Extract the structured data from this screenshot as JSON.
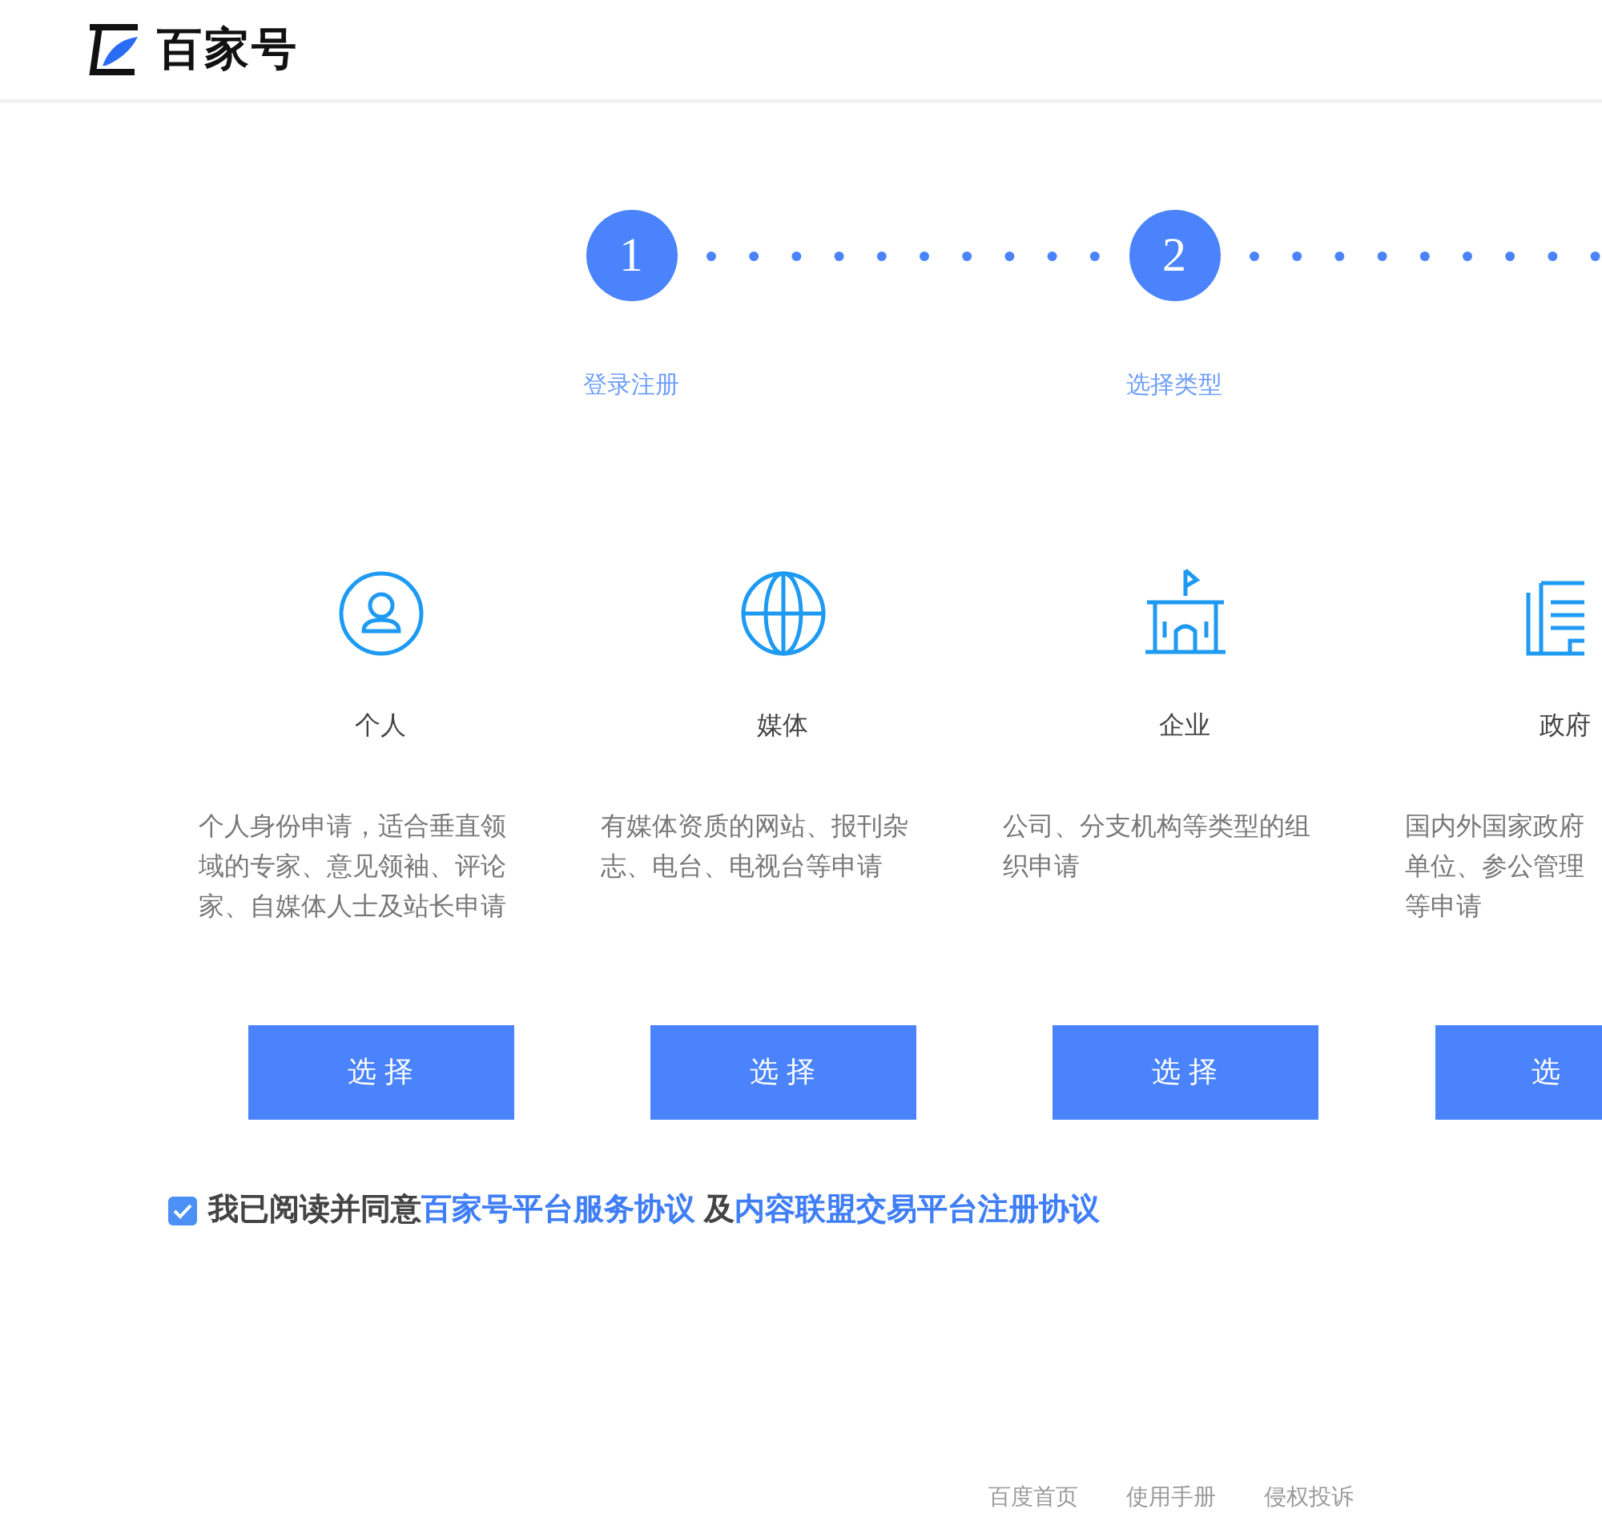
{
  "header": {
    "logo_text": "百家号"
  },
  "steps": [
    {
      "number": "1",
      "label": "登录注册"
    },
    {
      "number": "2",
      "label": "选择类型"
    }
  ],
  "cards": [
    {
      "kind": "person",
      "title": "个人",
      "lines": [
        "个人身份申请，适合垂直领",
        "域的专家、意见领袖、评论",
        "家、自媒体人士及站长申请"
      ],
      "button": "选 择"
    },
    {
      "kind": "globe",
      "title": "媒体",
      "lines": [
        "有媒体资质的网站、报刊杂",
        "志、电台、电视台等申请"
      ],
      "button": "选 择"
    },
    {
      "kind": "school",
      "title": "企业",
      "lines": [
        "公司、分支机构等类型的组",
        "织申请"
      ],
      "button": "选 择"
    },
    {
      "kind": "office",
      "title": "政府",
      "lines": [
        "国内外国家政府",
        "单位、参公管理",
        "等申请"
      ],
      "button": "选"
    }
  ],
  "agreement": {
    "checked": true,
    "text": "我已阅读并同意",
    "link_1": "百家号平台服务协议",
    "joiner": "及",
    "link_2": "内容联盟交易平台注册协议"
  },
  "footer": [
    "百度首页",
    "使用手册",
    "侵权投诉"
  ]
}
